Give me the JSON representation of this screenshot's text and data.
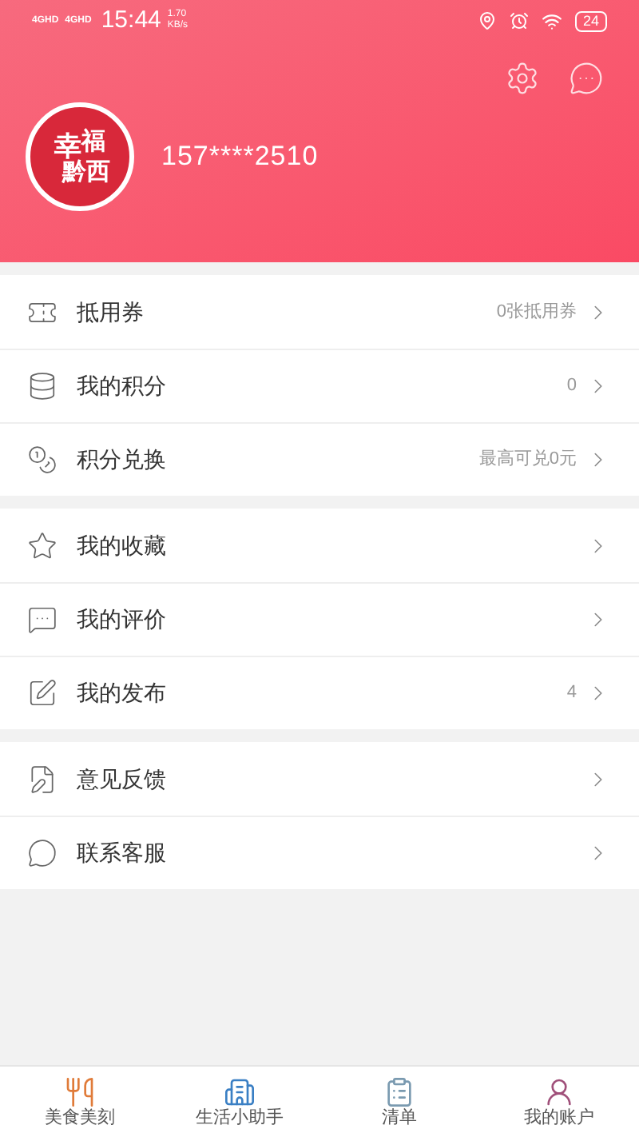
{
  "status_bar": {
    "signal_labels": [
      "4GHD",
      "4GHD"
    ],
    "time": "15:44",
    "speed": [
      "1.70",
      "KB/s"
    ],
    "battery": "24"
  },
  "profile": {
    "logo_text": [
      "幸",
      "福",
      "黔西"
    ],
    "phone": "157****2510"
  },
  "menu_groups": [
    [
      {
        "kind": "ticket",
        "label": "抵用券",
        "value": "0张抵用券"
      },
      {
        "kind": "points",
        "label": "我的积分",
        "value": "0"
      },
      {
        "kind": "exchange",
        "label": "积分兑换",
        "value": "最高可兑0元"
      }
    ],
    [
      {
        "kind": "favorite",
        "label": "我的收藏"
      },
      {
        "kind": "review",
        "label": "我的评价"
      },
      {
        "kind": "post",
        "label": "我的发布",
        "value": "4"
      }
    ],
    [
      {
        "kind": "feedback",
        "label": "意见反馈"
      },
      {
        "kind": "service",
        "label": "联系客服"
      }
    ]
  ],
  "tab_bar": [
    {
      "kind": "food",
      "label": "美食美刻"
    },
    {
      "kind": "life",
      "label": "生活小助手"
    },
    {
      "kind": "list",
      "label": "清单"
    },
    {
      "kind": "account",
      "label": "我的账户"
    }
  ]
}
